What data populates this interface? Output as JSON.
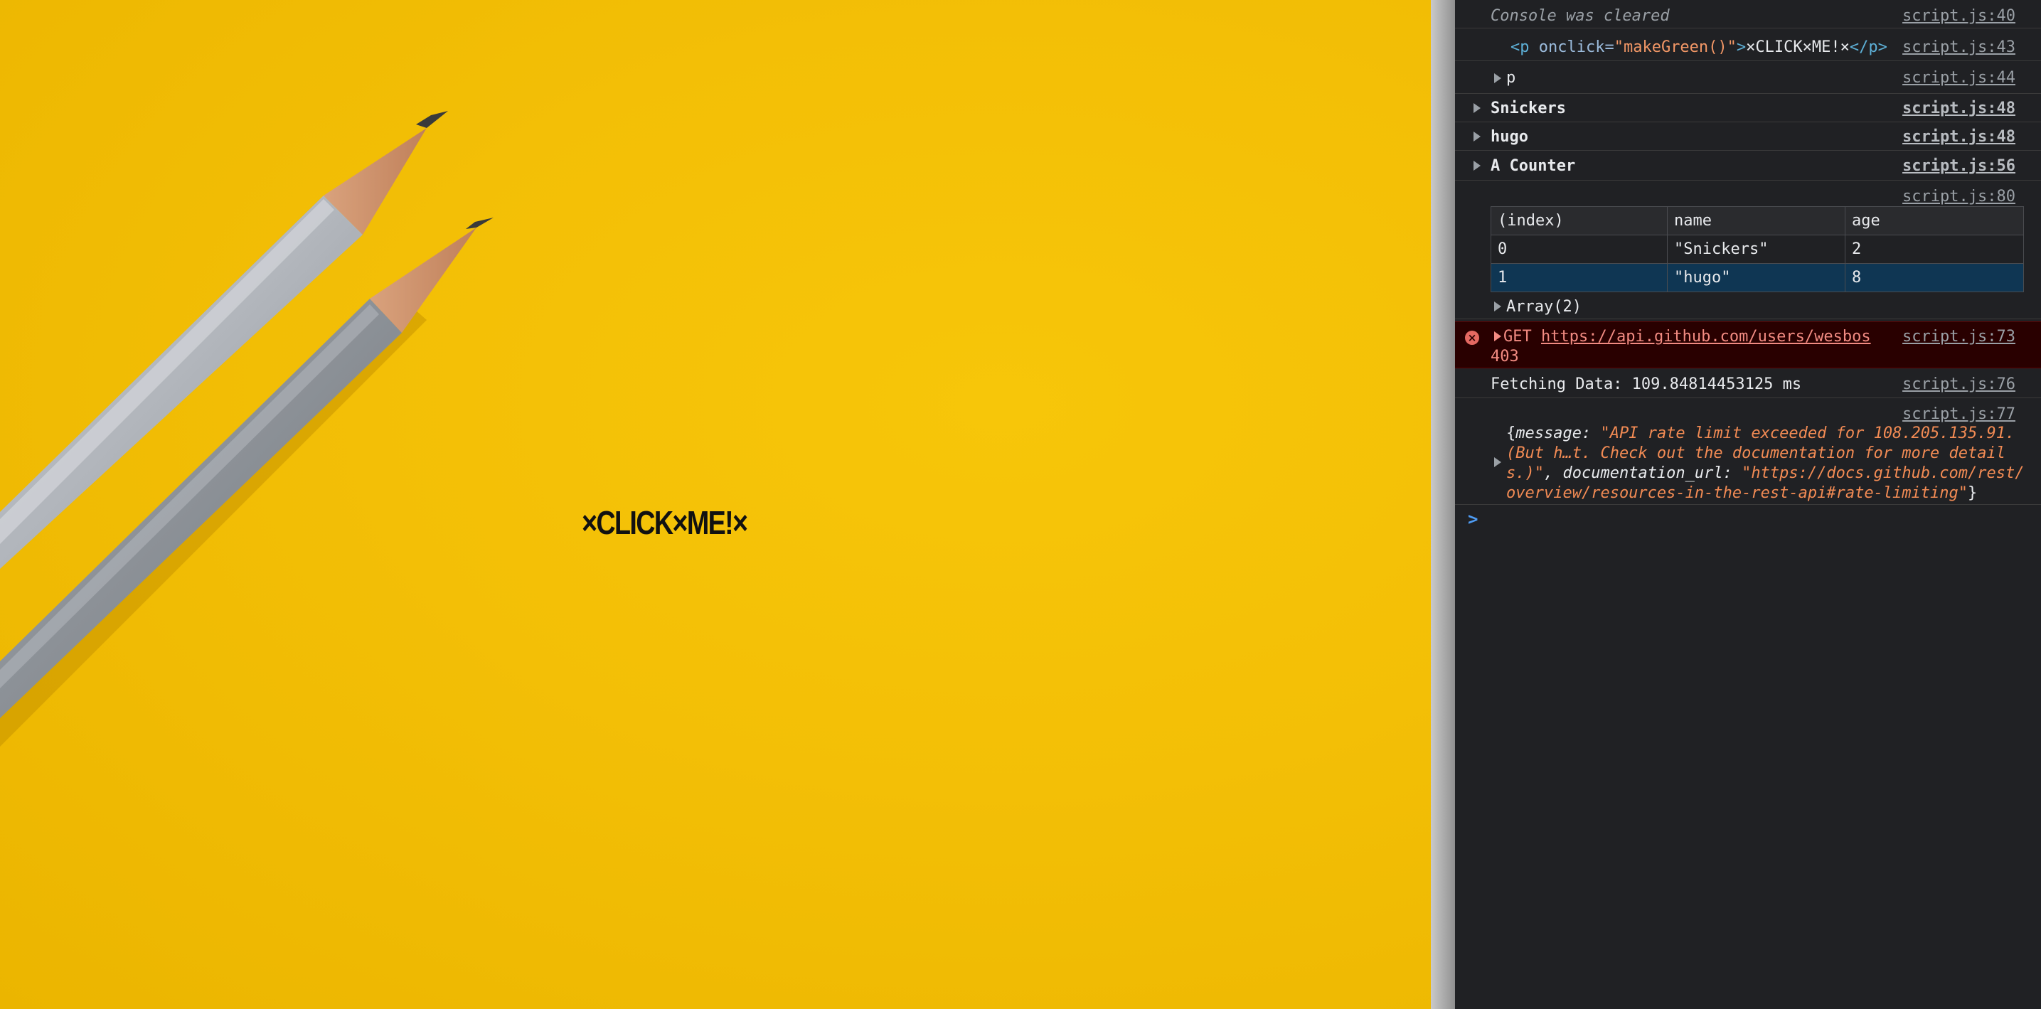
{
  "page": {
    "click_text": "×CLICK×ME!×"
  },
  "console": {
    "rows": {
      "cleared": {
        "message": "Console was cleared",
        "source": "script.js:40"
      },
      "element": {
        "tag_open": "<p",
        "attr_name": "onclick",
        "attr_eq": "=",
        "attr_value": "\"makeGreen()\"",
        "tag_close_start": ">",
        "text": "×CLICK×ME!×",
        "tag_end": "</p>",
        "source": "script.js:43"
      },
      "p_node": {
        "message": "p",
        "source": "script.js:44"
      },
      "snickers": {
        "message": "Snickers",
        "source": "script.js:48"
      },
      "hugo": {
        "message": "hugo",
        "source": "script.js:48"
      },
      "counter": {
        "message": "A Counter",
        "source": "script.js:56"
      },
      "table_row": {
        "source": "script.js:80"
      },
      "array": {
        "message": "Array(2)"
      },
      "error": {
        "method": "GET",
        "url": "https://api.github.com/users/wesbos",
        "status": "403",
        "source": "script.js:73"
      },
      "timer": {
        "message": "Fetching Data: 109.84814453125 ms",
        "source": "script.js:76"
      },
      "object": {
        "source": "script.js:77",
        "open": "{",
        "key1": "message",
        "colon1": ": ",
        "val1_line1": "\"API rate limit exceeded for 108.205.135.91.",
        "val1_line2": "(But h…t. Check out the documentation for more detail",
        "val1_line3": "s.)\"",
        "comma": ", ",
        "key2": "documentation_url",
        "colon2": ": ",
        "val2_line1": "\"https://docs.github.com/rest/",
        "val2_line2": "overview/resources-in-the-rest-api#rate-limiting\"",
        "close": "}"
      }
    },
    "table": {
      "headers": [
        "(index)",
        "name",
        "age"
      ],
      "rows": [
        [
          "0",
          "\"Snickers\"",
          "2"
        ],
        [
          "1",
          "\"hugo\"",
          "8"
        ]
      ]
    },
    "prompt": ">"
  },
  "colors": {
    "background_yellow": "#f3bf06",
    "console_bg": "#202124",
    "error_bg": "#290000",
    "string": "#f28b54",
    "number": "#9980ff"
  }
}
